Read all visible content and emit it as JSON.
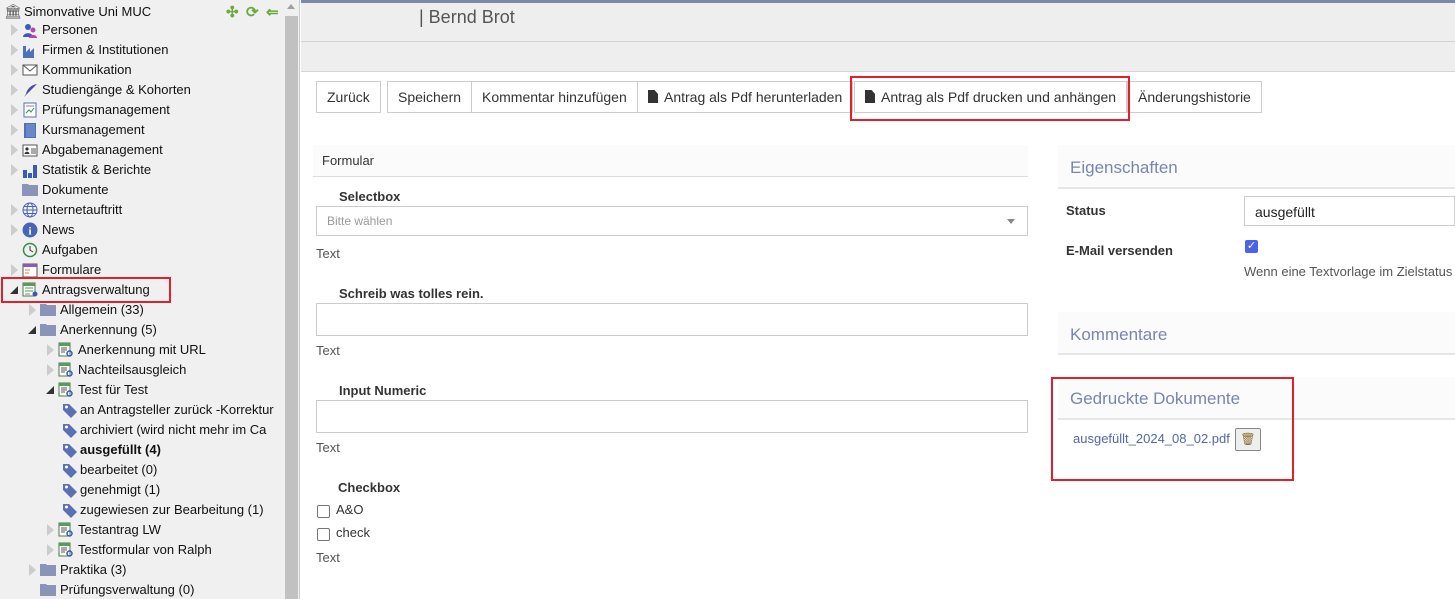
{
  "sidebar": {
    "root": "Simonvative Uni MUC",
    "items": [
      {
        "label": "Personen",
        "level": 0,
        "toggle": "closed",
        "icon": "persons-icon"
      },
      {
        "label": "Firmen & Institutionen",
        "level": 0,
        "toggle": "closed",
        "icon": "factory-icon"
      },
      {
        "label": "Kommunikation",
        "level": 0,
        "toggle": "closed",
        "icon": "envelope-icon"
      },
      {
        "label": "Studiengänge & Kohorten",
        "level": 0,
        "toggle": "closed",
        "icon": "feather-icon"
      },
      {
        "label": "Prüfungsmanagement",
        "level": 0,
        "toggle": "closed",
        "icon": "exam-icon"
      },
      {
        "label": "Kursmanagement",
        "level": 0,
        "toggle": "closed",
        "icon": "book-icon"
      },
      {
        "label": "Abgabemanagement",
        "level": 0,
        "toggle": "closed",
        "icon": "id-card-icon"
      },
      {
        "label": "Statistik & Berichte",
        "level": 0,
        "toggle": "closed",
        "icon": "bar-chart-icon"
      },
      {
        "label": "Dokumente",
        "level": 0,
        "toggle": "none",
        "icon": "folder-icon"
      },
      {
        "label": "Internetauftritt",
        "level": 0,
        "toggle": "closed",
        "icon": "globe-icon"
      },
      {
        "label": "News",
        "level": 0,
        "toggle": "closed",
        "icon": "info-icon"
      },
      {
        "label": "Aufgaben",
        "level": 0,
        "toggle": "none",
        "icon": "clock-icon"
      },
      {
        "label": "Formulare",
        "level": 0,
        "toggle": "closed",
        "icon": "form-icon"
      },
      {
        "label": "Antragsverwaltung",
        "level": 0,
        "toggle": "open",
        "icon": "application-icon"
      },
      {
        "label": "Allgemein (33)",
        "level": 1,
        "toggle": "closed",
        "icon": "folder-icon"
      },
      {
        "label": "Anerkennung (5)",
        "level": 1,
        "toggle": "open",
        "icon": "folder-icon"
      },
      {
        "label": "Anerkennung mit URL",
        "level": 2,
        "toggle": "closed",
        "icon": "form-search-icon"
      },
      {
        "label": "Nachteilsausgleich",
        "level": 2,
        "toggle": "closed",
        "icon": "form-search-icon"
      },
      {
        "label": "Test für Test",
        "level": 2,
        "toggle": "open",
        "icon": "form-search-icon"
      },
      {
        "label": "an Antragsteller zurück -Korrektur",
        "level": 3,
        "toggle": "none",
        "icon": "tag-icon"
      },
      {
        "label": "archiviert (wird nicht mehr im Ca",
        "level": 3,
        "toggle": "none",
        "icon": "tag-icon"
      },
      {
        "label": "ausgefüllt (4)",
        "level": 3,
        "toggle": "none",
        "icon": "tag-icon",
        "bold": true
      },
      {
        "label": "bearbeitet (0)",
        "level": 3,
        "toggle": "none",
        "icon": "tag-icon"
      },
      {
        "label": "genehmigt (1)",
        "level": 3,
        "toggle": "none",
        "icon": "tag-icon"
      },
      {
        "label": "zugewiesen zur Bearbeitung (1)",
        "level": 3,
        "toggle": "none",
        "icon": "tag-icon"
      },
      {
        "label": "Testantrag LW",
        "level": 2,
        "toggle": "closed",
        "icon": "form-search-icon"
      },
      {
        "label": "Testformular von Ralph",
        "level": 2,
        "toggle": "closed",
        "icon": "form-search-icon"
      },
      {
        "label": "Praktika (3)",
        "level": 1,
        "toggle": "closed",
        "icon": "folder-icon"
      },
      {
        "label": "Prüfungsverwaltung (0)",
        "level": 1,
        "toggle": "none",
        "icon": "folder-icon"
      }
    ]
  },
  "header": {
    "title": "| Bernd Brot"
  },
  "toolbar": {
    "back": "Zurück",
    "save": "Speichern",
    "comment": "Kommentar hinzufügen",
    "download_pdf": "Antrag als Pdf herunterladen",
    "print_pdf": "Antrag als Pdf drucken und anhängen",
    "history": "Änderungshistorie"
  },
  "form": {
    "title": "Formular",
    "selectbox_label": "Selectbox",
    "selectbox_placeholder": "Bitte wählen",
    "selectbox_hint": "Text",
    "text_label": "Schreib was tolles rein.",
    "text_hint": "Text",
    "numeric_label": "Input Numeric",
    "numeric_hint": "Text",
    "checkbox_label": "Checkbox",
    "checkbox_options": [
      "A&O",
      "check"
    ],
    "checkbox_hint": "Text"
  },
  "properties": {
    "title": "Eigenschaften",
    "status_label": "Status",
    "status_value": "ausgefüllt",
    "email_label": "E-Mail versenden",
    "email_checked": true,
    "email_hint": "Wenn eine Textvorlage im Zielstatus"
  },
  "comments": {
    "title": "Kommentare"
  },
  "printed": {
    "title": "Gedruckte Dokumente",
    "files": [
      "ausgefüllt_2024_08_02.pdf"
    ]
  },
  "colors": {
    "accent": "#7786b2",
    "highlight": "#e0202a",
    "checkbox": "#4a63e8"
  }
}
